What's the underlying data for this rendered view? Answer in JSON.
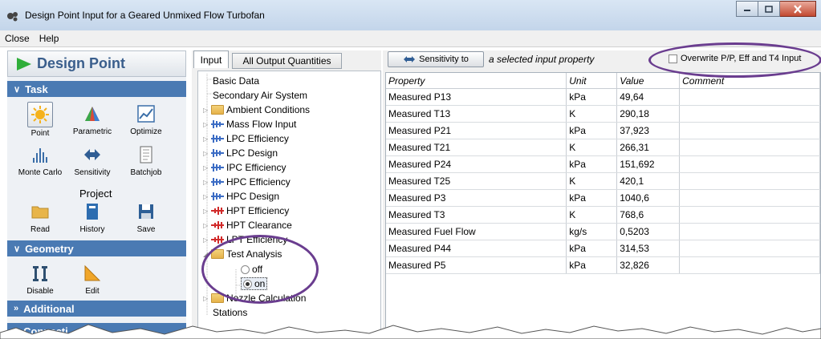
{
  "window": {
    "title": "Design Point Input for a Geared Unmixed Flow Turbofan",
    "controls": [
      "minimize-icon",
      "maximize-icon",
      "close-icon"
    ]
  },
  "menu": [
    "Close",
    "Help"
  ],
  "left": {
    "header": "Design Point",
    "sections": {
      "task": "Task",
      "geometry": "Geometry",
      "additional": "Additional",
      "connections": "Connecti"
    },
    "task_tools": [
      {
        "label": "Point",
        "icon": "sun-icon",
        "selected": true
      },
      {
        "label": "Parametric",
        "icon": "parametric-icon",
        "selected": false
      },
      {
        "label": "Optimize",
        "icon": "chart-icon",
        "selected": false
      },
      {
        "label": "Monte Carlo",
        "icon": "histogram-icon",
        "selected": false
      },
      {
        "label": "Sensitivity",
        "icon": "double-arrow-icon",
        "selected": false
      },
      {
        "label": "Batchjob",
        "icon": "document-icon",
        "selected": false
      }
    ],
    "project_label": "Project",
    "project_tools": [
      {
        "label": "Read",
        "icon": "folder-icon"
      },
      {
        "label": "History",
        "icon": "book-icon"
      },
      {
        "label": "Save",
        "icon": "floppy-icon"
      }
    ],
    "geometry_tools": [
      {
        "label": "Disable",
        "icon": "disable-icon"
      },
      {
        "label": "Edit",
        "icon": "ruler-icon"
      }
    ]
  },
  "tabs": {
    "input": "Input",
    "output": "All Output Quantities"
  },
  "tree": {
    "basic_data": "Basic Data",
    "secondary_air": "Secondary Air System",
    "ambient": "Ambient Conditions",
    "mass_flow": "Mass Flow Input",
    "lpc_eff": "LPC Efficiency",
    "lpc_design": "LPC Design",
    "ipc_eff": "IPC Efficiency",
    "hpc_eff": "HPC Efficiency",
    "hpc_design": "HPC Design",
    "hpt_eff": "HPT Efficiency",
    "hpt_clearance": "HPT Clearance",
    "lpt_eff": "LPT Efficiency",
    "test_analysis": "Test Analysis",
    "off": "off",
    "on": "on",
    "nozzle": "Nozzle Calculation",
    "stations": "Stations"
  },
  "right": {
    "sensitivity_button": "Sensitivity to",
    "sensitivity_text": "a selected input property",
    "overwrite_label": "Overwrite P/P, Eff and T4 Input",
    "overwrite_checked": false,
    "columns": [
      "Property",
      "Unit",
      "Value",
      "Comment"
    ],
    "rows": [
      [
        "Measured P13",
        "kPa",
        "49,64",
        ""
      ],
      [
        "Measured T13",
        "K",
        "290,18",
        ""
      ],
      [
        "Measured P21",
        "kPa",
        "37,923",
        ""
      ],
      [
        "Measured T21",
        "K",
        "266,31",
        ""
      ],
      [
        "Measured P24",
        "kPa",
        "151,692",
        ""
      ],
      [
        "Measured T25",
        "K",
        "420,1",
        ""
      ],
      [
        "Measured P3",
        "kPa",
        "1040,6",
        ""
      ],
      [
        "Measured T3",
        "K",
        "768,6",
        ""
      ],
      [
        "Measured Fuel Flow",
        "kg/s",
        "0,5203",
        ""
      ],
      [
        "Measured P44",
        "kPa",
        "314,53",
        ""
      ],
      [
        "Measured P5",
        "kPa",
        "32,826",
        ""
      ]
    ]
  },
  "colors": {
    "section": "#4a7ab3",
    "header_text": "#3a5e8c",
    "highlight_ring": "#6a3d8f"
  }
}
